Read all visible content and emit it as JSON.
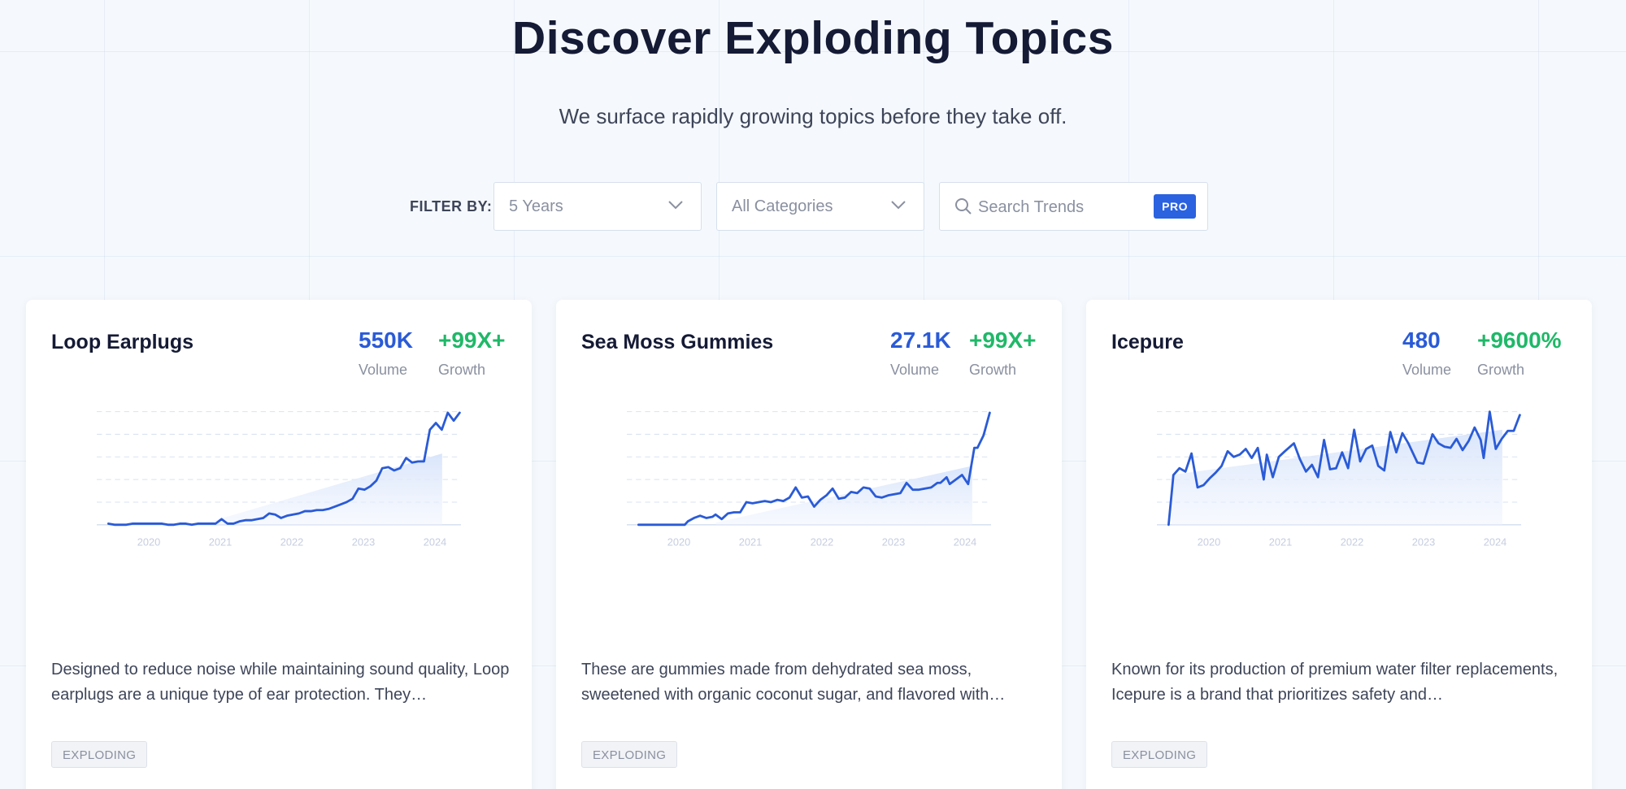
{
  "header": {
    "title": "Discover Exploding Topics",
    "subtitle": "We surface rapidly growing topics before they take off."
  },
  "filters": {
    "label": "FILTER BY:",
    "time_range": "5 Years",
    "category": "All Categories",
    "search_placeholder": "Search Trends",
    "pro_badge": "PRO"
  },
  "colors": {
    "accent": "#2a5bd7",
    "growth": "#1fb868",
    "line": "#2a5bd7"
  },
  "cards": [
    {
      "title": "Loop Earplugs",
      "volume": "550K",
      "volume_label": "Volume",
      "growth": "+99X+",
      "growth_label": "Growth",
      "description": "Designed to reduce noise while maintaining sound quality, Loop earplugs are a unique type of ear protection. They…",
      "status": "EXPLODING"
    },
    {
      "title": "Sea Moss Gummies",
      "volume": "27.1K",
      "volume_label": "Volume",
      "growth": "+99X+",
      "growth_label": "Growth",
      "description": "These are gummies made from dehydrated sea moss, sweetened with organic coconut sugar, and flavored with…",
      "status": "EXPLODING"
    },
    {
      "title": "Icepure",
      "volume": "480",
      "volume_label": "Volume",
      "growth": "+9600%",
      "growth_label": "Growth",
      "description": "Known for its production of premium water filter replacements, Icepure is a brand that prioritizes safety and…",
      "status": "EXPLODING"
    }
  ],
  "chart_data": [
    {
      "type": "line",
      "x_ticks": [
        "2020",
        "2021",
        "2022",
        "2023",
        "2024"
      ],
      "x_range": [
        2019.3,
        2024.4
      ],
      "ylim": [
        0,
        100
      ],
      "grid": true,
      "trend_area": [
        [
          2020.9,
          1
        ],
        [
          2024.25,
          63
        ]
      ],
      "points": [
        [
          2019.3,
          1
        ],
        [
          2019.4,
          0
        ],
        [
          2019.5,
          0
        ],
        [
          2019.6,
          0
        ],
        [
          2019.7,
          1
        ],
        [
          2019.8,
          1
        ],
        [
          2019.9,
          1
        ],
        [
          2020.0,
          1
        ],
        [
          2020.1,
          1
        ],
        [
          2020.2,
          1
        ],
        [
          2020.3,
          0
        ],
        [
          2020.4,
          0
        ],
        [
          2020.5,
          1
        ],
        [
          2020.6,
          1
        ],
        [
          2020.7,
          0
        ],
        [
          2020.8,
          1
        ],
        [
          2020.9,
          1
        ],
        [
          2021.0,
          1
        ],
        [
          2021.1,
          1
        ],
        [
          2021.2,
          5
        ],
        [
          2021.3,
          1
        ],
        [
          2021.4,
          1
        ],
        [
          2021.5,
          3
        ],
        [
          2021.6,
          4
        ],
        [
          2021.7,
          4
        ],
        [
          2021.8,
          5
        ],
        [
          2021.9,
          6
        ],
        [
          2022.0,
          10
        ],
        [
          2022.1,
          9
        ],
        [
          2022.2,
          6
        ],
        [
          2022.3,
          8
        ],
        [
          2022.4,
          9
        ],
        [
          2022.5,
          10
        ],
        [
          2022.6,
          12
        ],
        [
          2022.7,
          12
        ],
        [
          2022.8,
          13
        ],
        [
          2022.9,
          13
        ],
        [
          2023.0,
          14
        ],
        [
          2023.1,
          16
        ],
        [
          2023.2,
          18
        ],
        [
          2023.3,
          20
        ],
        [
          2023.4,
          23
        ],
        [
          2023.5,
          32
        ],
        [
          2023.6,
          31
        ],
        [
          2023.7,
          34
        ],
        [
          2023.8,
          39
        ],
        [
          2023.9,
          50
        ],
        [
          2024.0,
          51
        ],
        [
          2024.1,
          48
        ],
        [
          2024.2,
          50
        ],
        [
          2024.3,
          59
        ],
        [
          2024.4,
          55
        ],
        [
          2024.5,
          56
        ],
        [
          2024.6,
          56
        ],
        [
          2024.7,
          84
        ],
        [
          2024.8,
          90
        ],
        [
          2024.9,
          84
        ],
        [
          2025.0,
          99
        ],
        [
          2025.1,
          92
        ],
        [
          2025.2,
          99
        ]
      ]
    },
    {
      "type": "line",
      "x_ticks": [
        "2020",
        "2021",
        "2022",
        "2023",
        "2024"
      ],
      "x_range": [
        2019.3,
        2024.4
      ],
      "ylim": [
        0,
        100
      ],
      "grid": true,
      "trend_area": [
        [
          2020.6,
          2
        ],
        [
          2024.25,
          52
        ]
      ],
      "points": [
        [
          2019.3,
          0
        ],
        [
          2019.5,
          0
        ],
        [
          2019.7,
          0
        ],
        [
          2019.9,
          0
        ],
        [
          2020.05,
          0
        ],
        [
          2020.1,
          3
        ],
        [
          2020.2,
          6
        ],
        [
          2020.3,
          8
        ],
        [
          2020.4,
          6
        ],
        [
          2020.5,
          7
        ],
        [
          2020.55,
          9
        ],
        [
          2020.65,
          5
        ],
        [
          2020.75,
          10
        ],
        [
          2020.85,
          11
        ],
        [
          2020.95,
          11
        ],
        [
          2021.05,
          20
        ],
        [
          2021.15,
          19
        ],
        [
          2021.25,
          20
        ],
        [
          2021.35,
          21
        ],
        [
          2021.45,
          20
        ],
        [
          2021.55,
          22
        ],
        [
          2021.65,
          21
        ],
        [
          2021.75,
          24
        ],
        [
          2021.85,
          33
        ],
        [
          2021.95,
          24
        ],
        [
          2022.05,
          25
        ],
        [
          2022.15,
          16
        ],
        [
          2022.25,
          22
        ],
        [
          2022.35,
          26
        ],
        [
          2022.45,
          32
        ],
        [
          2022.55,
          23
        ],
        [
          2022.65,
          24
        ],
        [
          2022.75,
          29
        ],
        [
          2022.85,
          28
        ],
        [
          2022.95,
          33
        ],
        [
          2023.05,
          32
        ],
        [
          2023.15,
          25
        ],
        [
          2023.25,
          24
        ],
        [
          2023.35,
          26
        ],
        [
          2023.45,
          27
        ],
        [
          2023.55,
          28
        ],
        [
          2023.65,
          37
        ],
        [
          2023.75,
          31
        ],
        [
          2023.85,
          31
        ],
        [
          2023.95,
          32
        ],
        [
          2024.05,
          33
        ],
        [
          2024.15,
          37
        ],
        [
          2024.2,
          37
        ],
        [
          2024.3,
          42
        ],
        [
          2024.35,
          36
        ],
        [
          2024.45,
          40
        ],
        [
          2024.55,
          44
        ],
        [
          2024.65,
          36
        ],
        [
          2024.75,
          68
        ],
        [
          2024.8,
          68
        ],
        [
          2024.9,
          79
        ],
        [
          2025.0,
          99
        ]
      ]
    },
    {
      "type": "line",
      "x_ticks": [
        "2020",
        "2021",
        "2022",
        "2023",
        "2024"
      ],
      "x_range": [
        2019.3,
        2024.4
      ],
      "ylim": [
        0,
        100
      ],
      "grid": true,
      "trend_area": [
        [
          2019.35,
          44
        ],
        [
          2024.25,
          84
        ]
      ],
      "points": [
        [
          2019.32,
          0
        ],
        [
          2019.4,
          44
        ],
        [
          2019.5,
          50
        ],
        [
          2019.6,
          47
        ],
        [
          2019.7,
          63
        ],
        [
          2019.8,
          33
        ],
        [
          2019.9,
          35
        ],
        [
          2020.0,
          41
        ],
        [
          2020.1,
          46
        ],
        [
          2020.2,
          52
        ],
        [
          2020.3,
          65
        ],
        [
          2020.4,
          60
        ],
        [
          2020.5,
          62
        ],
        [
          2020.6,
          67
        ],
        [
          2020.7,
          59
        ],
        [
          2020.8,
          68
        ],
        [
          2020.9,
          40
        ],
        [
          2020.95,
          62
        ],
        [
          2021.05,
          42
        ],
        [
          2021.15,
          60
        ],
        [
          2021.25,
          65
        ],
        [
          2021.4,
          72
        ],
        [
          2021.5,
          58
        ],
        [
          2021.6,
          47
        ],
        [
          2021.7,
          53
        ],
        [
          2021.8,
          42
        ],
        [
          2021.9,
          75
        ],
        [
          2022.0,
          49
        ],
        [
          2022.1,
          50
        ],
        [
          2022.2,
          64
        ],
        [
          2022.3,
          50
        ],
        [
          2022.4,
          84
        ],
        [
          2022.5,
          56
        ],
        [
          2022.6,
          67
        ],
        [
          2022.7,
          70
        ],
        [
          2022.8,
          52
        ],
        [
          2022.9,
          48
        ],
        [
          2023.0,
          82
        ],
        [
          2023.1,
          64
        ],
        [
          2023.2,
          81
        ],
        [
          2023.3,
          72
        ],
        [
          2023.45,
          55
        ],
        [
          2023.55,
          54
        ],
        [
          2023.7,
          80
        ],
        [
          2023.8,
          72
        ],
        [
          2023.9,
          69
        ],
        [
          2024.0,
          68
        ],
        [
          2024.1,
          76
        ],
        [
          2024.2,
          66
        ],
        [
          2024.3,
          74
        ],
        [
          2024.4,
          86
        ],
        [
          2024.5,
          75
        ],
        [
          2024.55,
          59
        ],
        [
          2024.65,
          100
        ],
        [
          2024.75,
          67
        ],
        [
          2024.85,
          76
        ],
        [
          2024.95,
          83
        ],
        [
          2025.05,
          83
        ],
        [
          2025.15,
          97
        ]
      ]
    }
  ]
}
